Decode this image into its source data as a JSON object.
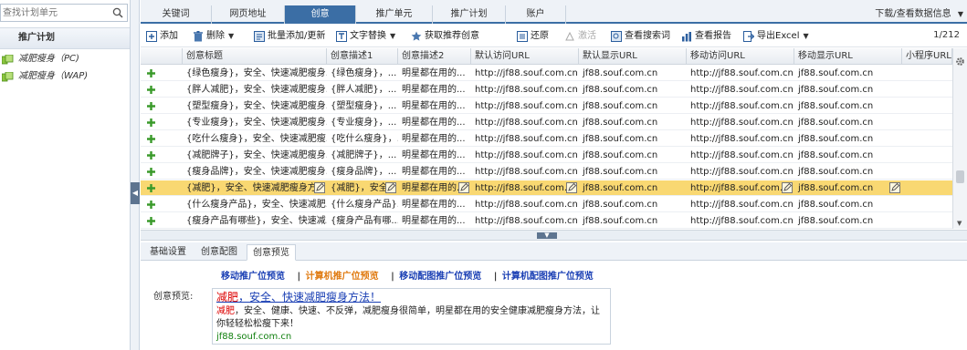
{
  "sidebar": {
    "search_placeholder": "查找计划单元",
    "header": "推广计划",
    "items": [
      {
        "label": "减肥瘦身（PC)"
      },
      {
        "label": "减肥瘦身（WAP)"
      }
    ]
  },
  "tabs": [
    {
      "label": "关键词"
    },
    {
      "label": "网页地址"
    },
    {
      "label": "创意"
    },
    {
      "label": "推广单元"
    },
    {
      "label": "推广计划"
    },
    {
      "label": "账户"
    }
  ],
  "download_label": "下载/查看数据信息",
  "toolbar": {
    "add": "添加",
    "delete": "删除",
    "batch": "批量添加/更新",
    "replace": "文字替换",
    "fetch": "获取推荐创意",
    "restore": "还原",
    "activate": "激活",
    "search_words": "查看搜索词",
    "report": "查看报告",
    "export": "导出Excel"
  },
  "page_info": "1/212",
  "grid": {
    "headers": [
      "创意标题",
      "创意描述1",
      "创意描述2",
      "默认访问URL",
      "默认显示URL",
      "移动访问URL",
      "移动显示URL",
      "小程序URL"
    ],
    "rows": [
      [
        "{绿色瘦身}，安全、快速减肥瘦身...",
        "{绿色瘦身}，...",
        "明星都在用的...",
        "http://jf88.souf.com.cn",
        "jf88.souf.com.cn",
        "http://jf88.souf.com.cn",
        "jf88.souf.com.cn",
        ""
      ],
      [
        "{胖人减肥}，安全、快速减肥瘦身...",
        "{胖人减肥}，...",
        "明星都在用的...",
        "http://jf88.souf.com.cn",
        "jf88.souf.com.cn",
        "http://jf88.souf.com.cn",
        "jf88.souf.com.cn",
        ""
      ],
      [
        "{塑型瘦身}，安全、快速减肥瘦身...",
        "{塑型瘦身}，...",
        "明星都在用的...",
        "http://jf88.souf.com.cn",
        "jf88.souf.com.cn",
        "http://jf88.souf.com.cn",
        "jf88.souf.com.cn",
        ""
      ],
      [
        "{专业瘦身}，安全、快速减肥瘦身...",
        "{专业瘦身}，...",
        "明星都在用的...",
        "http://jf88.souf.com.cn",
        "jf88.souf.com.cn",
        "http://jf88.souf.com.cn",
        "jf88.souf.com.cn",
        ""
      ],
      [
        "{吃什么瘦身}，安全、快速减肥瘦...",
        "{吃什么瘦身}，...",
        "明星都在用的...",
        "http://jf88.souf.com.cn",
        "jf88.souf.com.cn",
        "http://jf88.souf.com.cn",
        "jf88.souf.com.cn",
        ""
      ],
      [
        "{减肥牌子}，安全、快速减肥瘦身...",
        "{减肥牌子}，...",
        "明星都在用的...",
        "http://jf88.souf.com.cn",
        "jf88.souf.com.cn",
        "http://jf88.souf.com.cn",
        "jf88.souf.com.cn",
        ""
      ],
      [
        "{瘦身品牌}，安全、快速减肥瘦身...",
        "{瘦身品牌}，...",
        "明星都在用的...",
        "http://jf88.souf.com.cn",
        "jf88.souf.com.cn",
        "http://jf88.souf.com.cn",
        "jf88.souf.com.cn",
        ""
      ],
      [
        "{减肥}，安全、快速减肥瘦身方法",
        "{减肥}，安全...",
        "明星都在用的...",
        "http://jf88.souf.com.cn",
        "jf88.souf.com.cn",
        "http://jf88.souf.com.cn",
        "jf88.souf.com.cn",
        ""
      ],
      [
        "{什么瘦身产品}，安全、快速减肥...",
        "{什么瘦身产品}...",
        "明星都在用的...",
        "http://jf88.souf.com.cn",
        "jf88.souf.com.cn",
        "http://jf88.souf.com.cn",
        "jf88.souf.com.cn",
        ""
      ],
      [
        "{瘦身产品有哪些}，安全、快速减...",
        "{瘦身产品有哪...",
        "明星都在用的...",
        "http://jf88.souf.com.cn",
        "jf88.souf.com.cn",
        "http://jf88.souf.com.cn",
        "jf88.souf.com.cn",
        ""
      ]
    ]
  },
  "bottom_tabs": [
    {
      "label": "基础设置"
    },
    {
      "label": "创意配图"
    },
    {
      "label": "创意预览"
    }
  ],
  "preview_links": {
    "mobile": "移动推广位预览",
    "pc": "计算机推广位预览",
    "mobile_image": "移动配图推广位预览",
    "pc_image": "计算机配图推广位预览",
    "separator": "|"
  },
  "preview": {
    "label": "创意预览:",
    "title_keyword": "减肥",
    "title_rest": "，安全、快速减肥瘦身方法！",
    "desc_keyword": "减肥",
    "desc_rest": "，安全、健康、快速、不反弹，减肥瘦身很简单，明星都在用的安全健康减肥瘦身方法，让你轻轻松松瘦下来！",
    "url": "jf88.souf.com.cn"
  },
  "colors": {
    "accent": "#3b6ea5",
    "selected_row": "#f9d872",
    "link_blue": "#1a3fb4",
    "link_orange": "#e07a10",
    "keyword_red": "#dd0000",
    "url_green": "#11800f"
  }
}
